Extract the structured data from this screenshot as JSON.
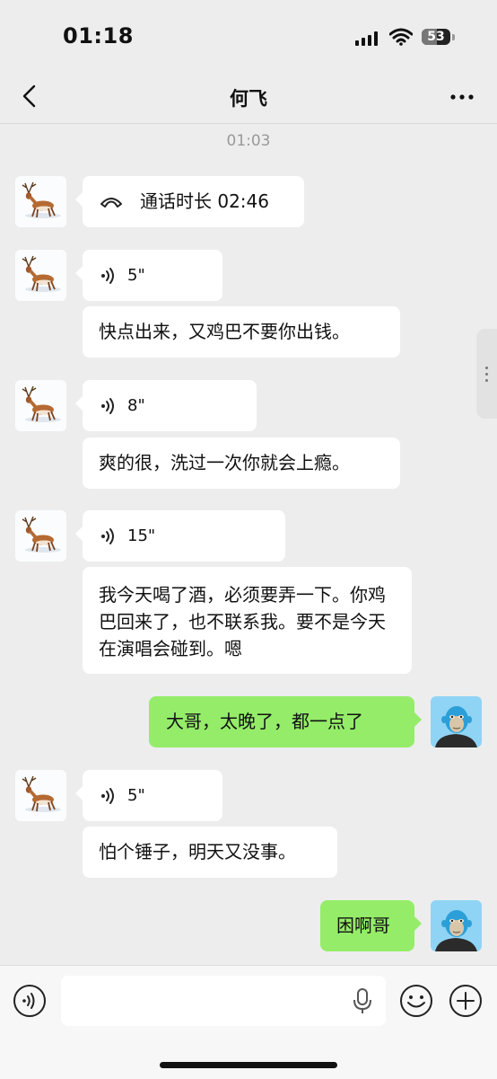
{
  "status": {
    "time": "01:18",
    "battery": "53"
  },
  "header": {
    "title": "何飞"
  },
  "timestamp": "01:03",
  "messages": {
    "call": {
      "text": "通话时长 02:46"
    },
    "v1": {
      "duration": "5\""
    },
    "t1": {
      "text": "快点出来，又鸡巴不要你出钱。"
    },
    "v2": {
      "duration": "8\""
    },
    "t2": {
      "text": "爽的很，洗过一次你就会上瘾。"
    },
    "v3": {
      "duration": "15\""
    },
    "t3": {
      "text": "我今天喝了酒，必须要弄一下。你鸡巴回来了，也不联系我。要不是今天在演唱会碰到。嗯"
    },
    "m1": {
      "text": "大哥，太晚了，都一点了"
    },
    "v4": {
      "duration": "5\""
    },
    "t4": {
      "text": "怕个锤子，明天又没事。"
    },
    "m2": {
      "text": "困啊哥"
    }
  },
  "colors": {
    "background": "#ededed",
    "my_bubble": "#95ec69",
    "other_bubble": "#ffffff"
  }
}
